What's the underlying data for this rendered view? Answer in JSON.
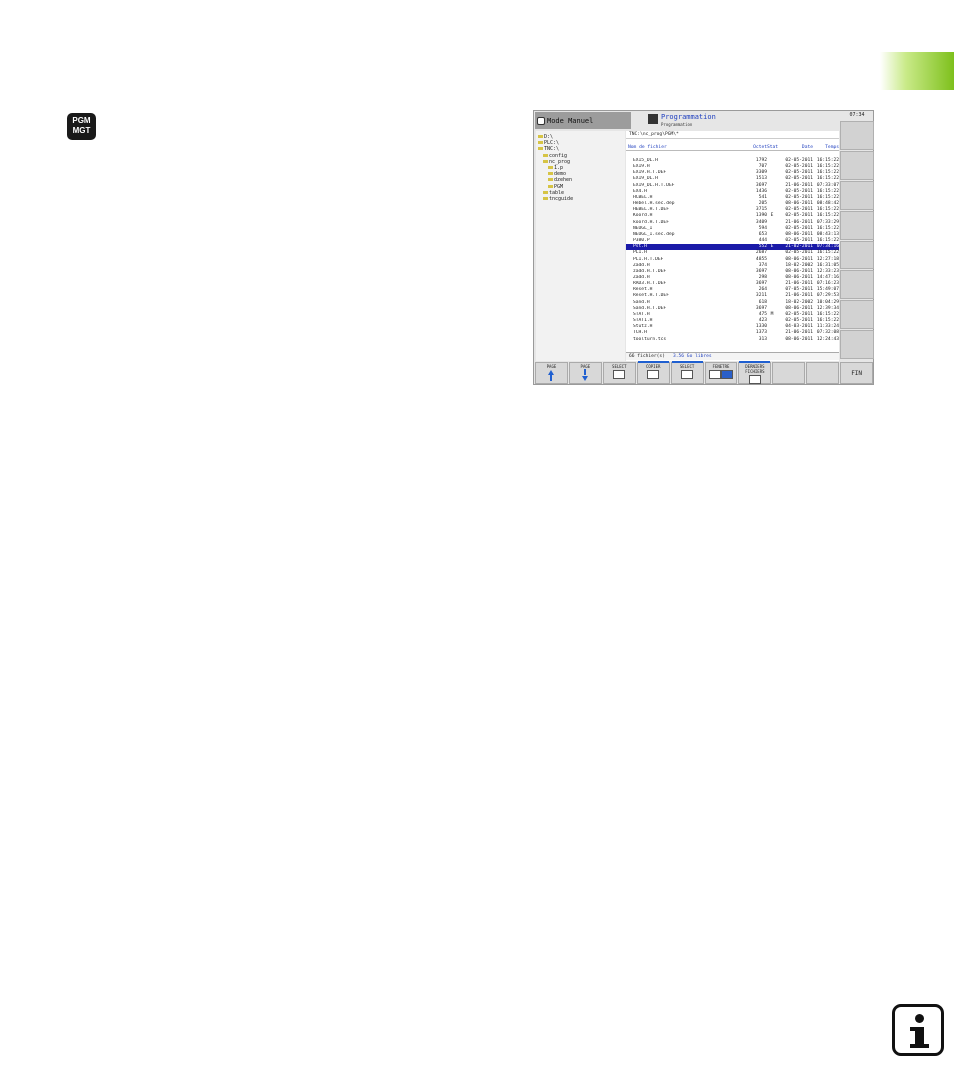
{
  "key": {
    "line1": "PGM",
    "line2": "MGT"
  },
  "screen": {
    "mode_label": "Mode Manuel",
    "prog_title": "Programmation",
    "prog_subtitle": "Programmation",
    "clock": "07:34",
    "path": "TNC:\\nc_prog\\PGM\\*",
    "tree": [
      {
        "label": "D:\\",
        "level": 0
      },
      {
        "label": "PLC:\\",
        "level": 0
      },
      {
        "label": "TNC:\\",
        "level": 0
      },
      {
        "label": "config",
        "level": 1
      },
      {
        "label": "nc_prog",
        "level": 1
      },
      {
        "label": "1.p",
        "level": 2
      },
      {
        "label": "demo",
        "level": 2
      },
      {
        "label": "dzehen",
        "level": 2
      },
      {
        "label": "PGM",
        "level": 2
      },
      {
        "label": "table",
        "level": 1
      },
      {
        "label": "tncguide",
        "level": 1
      }
    ],
    "columns": {
      "name": "Nom de fichier",
      "bytes": "Octet",
      "stat": "Stat",
      "date": "Date",
      "time": "Temps"
    },
    "rows": [
      [
        "EX15_DL.H",
        "1792",
        "",
        "02-05-2011",
        "16:15:22"
      ],
      [
        "EX19.H",
        "707",
        "",
        "02-05-2011",
        "16:15:22"
      ],
      [
        "EX19.H.T.DEF",
        "3309",
        "",
        "02-05-2011",
        "16:15:22"
      ],
      [
        "EX19_DL.H",
        "1513",
        "",
        "02-05-2011",
        "16:15:22"
      ],
      [
        "EX19_DL.H.T.DEF",
        "3697",
        "",
        "21-06-2011",
        "07:33:07"
      ],
      [
        "EX4.H",
        "1436",
        "",
        "02-05-2011",
        "16:15:22"
      ],
      [
        "HCBEL.H",
        "541",
        "",
        "02-05-2011",
        "16:15:22"
      ],
      [
        "Hebel.H.sec.dep",
        "205",
        "",
        "08-06-2011",
        "08:48:42"
      ],
      [
        "HEBEL.H.T.DEF",
        "3715",
        "",
        "02-05-2011",
        "16:15:22"
      ],
      [
        "Koord.H",
        "1390",
        "E",
        "02-05-2011",
        "16:15:22"
      ],
      [
        "koord.H.T.DEF",
        "3409",
        "",
        "21-06-2011",
        "07:33:29"
      ],
      [
        "NEUGL_I",
        "594",
        "",
        "02-05-2011",
        "16:15:22"
      ],
      [
        "NEUGL_I.sec.dep",
        "653",
        "",
        "08-06-2011",
        "08:43:13"
      ],
      [
        "P380.P",
        "444",
        "",
        "02-05-2011",
        "16:15:22"
      ],
      [
        "Pst.H",
        "552",
        "E",
        "21-02-2011",
        "07:34:16"
      ],
      [
        "PL1.H",
        "2687",
        "",
        "02-05-2011",
        "16:15:22"
      ],
      [
        "PL1.H.T.DEF",
        "4855",
        "",
        "08-06-2011",
        "12:27:18"
      ],
      [
        "Zadd.H",
        "374",
        "",
        "18-02-2002",
        "16:31:05"
      ],
      [
        "zadd.H.T.DEF",
        "3697",
        "",
        "08-06-2011",
        "12:33:23"
      ],
      [
        "Zadd.H",
        "298",
        "",
        "08-06-2011",
        "14:47:16"
      ],
      [
        "RAD3.H.T.DEF",
        "3697",
        "",
        "21-06-2011",
        "07:16:23"
      ],
      [
        "Reset.H",
        "264",
        "",
        "07-05-2011",
        "15:49:07"
      ],
      [
        "Reset.H.T.DEF",
        "3211",
        "",
        "21-06-2011",
        "07:29:53"
      ],
      [
        "Sand.H",
        "618",
        "",
        "18-02-2002",
        "10:04:29"
      ],
      [
        "Sand.H.T.DEF",
        "3697",
        "",
        "08-06-2011",
        "12:39:34"
      ],
      [
        "STAT.H",
        "475",
        "M",
        "02-05-2011",
        "16:15:22"
      ],
      [
        "STAT1.H",
        "423",
        "",
        "02-05-2011",
        "16:15:22"
      ],
      [
        "Stutz.H",
        "1330",
        "",
        "04-03-2011",
        "11:33:24"
      ],
      [
        "TCH.H",
        "1373",
        "",
        "21-06-2011",
        "07:32:08"
      ],
      [
        "toolturn.tcs",
        "313",
        "",
        "08-06-2011",
        "12:24:43"
      ]
    ],
    "selected_row": 14,
    "footer": {
      "count": "66 fichier(s)",
      "free": "3.56 Go libres"
    },
    "softkeys": [
      "PAGE",
      "PAGE",
      "SELECT",
      "COPIER",
      "SELECT",
      "FENETRE",
      "DERNIERS FICHIERS",
      "",
      "",
      "FIN"
    ]
  }
}
